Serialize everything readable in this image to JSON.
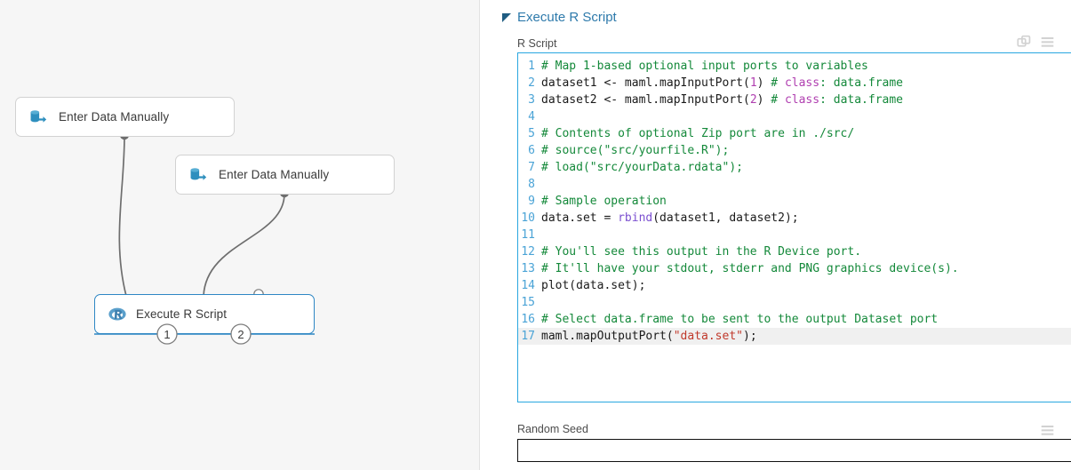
{
  "canvas": {
    "nodes": [
      {
        "id": "edm-1",
        "label": "Enter Data Manually",
        "icon": "database-export-icon",
        "selected": false
      },
      {
        "id": "edm-2",
        "label": "Enter Data Manually",
        "icon": "database-export-icon",
        "selected": false
      },
      {
        "id": "rscript",
        "label": "Execute R Script",
        "icon": "r-logo-icon",
        "selected": true
      }
    ],
    "ports": {
      "output_1": "1",
      "output_2": "2"
    },
    "colors": {
      "node_icon_teal": "#2e8fbe",
      "selected_border": "#2e87c4",
      "connector": "#6e6e6e",
      "canvas_bg": "#f6f6f6"
    }
  },
  "panel": {
    "title": "Execute R Script",
    "title_color": "#2e7aab",
    "collapse_icon": "triangle-collapse-icon",
    "header_icons": [
      {
        "name": "copy-icon",
        "label": "Copy"
      },
      {
        "name": "menu-icon",
        "label": "Menu"
      }
    ],
    "script_field": {
      "label": "R Script",
      "border_color": "#29a7e0",
      "current_line": 17,
      "lines": [
        {
          "n": "1",
          "tokens": [
            {
              "t": "# Map 1-based optional input ports to variables",
              "c": "comment"
            }
          ]
        },
        {
          "n": "2",
          "tokens": [
            {
              "t": "dataset1 <- maml.mapInputPort(",
              "c": "plain"
            },
            {
              "t": "1",
              "c": "num"
            },
            {
              "t": ") ",
              "c": "plain"
            },
            {
              "t": "# ",
              "c": "comment"
            },
            {
              "t": "class",
              "c": "kw"
            },
            {
              "t": ": data.frame",
              "c": "comment"
            }
          ]
        },
        {
          "n": "3",
          "tokens": [
            {
              "t": "dataset2 <- maml.mapInputPort(",
              "c": "plain"
            },
            {
              "t": "2",
              "c": "num"
            },
            {
              "t": ") ",
              "c": "plain"
            },
            {
              "t": "# ",
              "c": "comment"
            },
            {
              "t": "class",
              "c": "kw"
            },
            {
              "t": ": data.frame",
              "c": "comment"
            }
          ]
        },
        {
          "n": "4",
          "tokens": [
            {
              "t": "",
              "c": "plain"
            }
          ]
        },
        {
          "n": "5",
          "tokens": [
            {
              "t": "# Contents of optional Zip port are in ./src/",
              "c": "comment"
            }
          ]
        },
        {
          "n": "6",
          "tokens": [
            {
              "t": "# source(\"src/yourfile.R\");",
              "c": "comment"
            }
          ]
        },
        {
          "n": "7",
          "tokens": [
            {
              "t": "# load(\"src/yourData.rdata\");",
              "c": "comment"
            }
          ]
        },
        {
          "n": "8",
          "tokens": [
            {
              "t": "",
              "c": "plain"
            }
          ]
        },
        {
          "n": "9",
          "tokens": [
            {
              "t": "# Sample operation",
              "c": "comment"
            }
          ]
        },
        {
          "n": "10",
          "tokens": [
            {
              "t": "data.set = ",
              "c": "plain"
            },
            {
              "t": "rbind",
              "c": "fn"
            },
            {
              "t": "(dataset1, dataset2);",
              "c": "plain"
            }
          ]
        },
        {
          "n": "11",
          "tokens": [
            {
              "t": "",
              "c": "plain"
            }
          ]
        },
        {
          "n": "12",
          "tokens": [
            {
              "t": "# You'll see this output in the R Device port.",
              "c": "comment"
            }
          ]
        },
        {
          "n": "13",
          "tokens": [
            {
              "t": "# It'll have your stdout, stderr and PNG graphics device(s).",
              "c": "comment"
            }
          ]
        },
        {
          "n": "14",
          "tokens": [
            {
              "t": "plot(data.set);",
              "c": "plain"
            }
          ]
        },
        {
          "n": "15",
          "tokens": [
            {
              "t": "",
              "c": "plain"
            }
          ]
        },
        {
          "n": "16",
          "tokens": [
            {
              "t": "# Select data.frame to be sent to the output Dataset port",
              "c": "comment"
            }
          ]
        },
        {
          "n": "17",
          "tokens": [
            {
              "t": "maml.mapOutputPort(",
              "c": "plain"
            },
            {
              "t": "\"data.set\"",
              "c": "str"
            },
            {
              "t": ");",
              "c": "plain"
            }
          ]
        }
      ]
    },
    "seed_field": {
      "label": "Random Seed",
      "value": "",
      "placeholder": "",
      "menu_icon": "menu-icon"
    }
  }
}
